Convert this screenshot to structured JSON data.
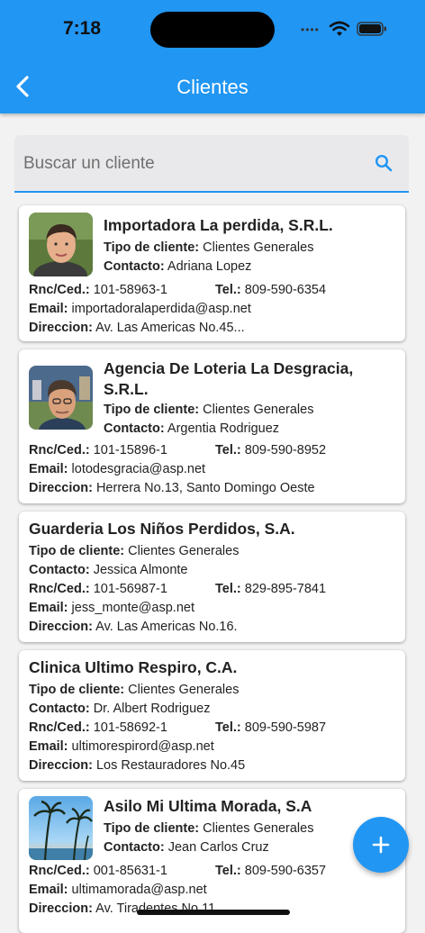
{
  "status": {
    "time": "7:18",
    "dots": "••••"
  },
  "header": {
    "title": "Clientes"
  },
  "search": {
    "placeholder": "Buscar un cliente"
  },
  "labels": {
    "tipo": "Tipo de cliente:",
    "contacto": "Contacto:",
    "rnc": "Rnc/Ced.:",
    "tel": "Tel.:",
    "email": "Email:",
    "direccion": "Direccion:"
  },
  "clients": [
    {
      "name": "Importadora La perdida, S.R.L.",
      "tipo": "Clientes Generales",
      "contacto": "Adriana Lopez",
      "rnc": "101-58963-1",
      "tel": "809-590-6354",
      "email": "importadoralaperdida@asp.net",
      "direccion": "Av. Las Americas No.45..."
    },
    {
      "name_line1": "Agencia De Loteria La Desgracia,",
      "name_line2": "S.R.L.",
      "tipo": "Clientes Generales",
      "contacto": "Argentia Rodriguez",
      "rnc": "101-15896-1",
      "tel": "809-590-8952",
      "email": "lotodesgracia@asp.net",
      "direccion": "Herrera No.13, Santo Domingo Oeste"
    },
    {
      "name": "Guarderia Los Niños Perdidos, S.A.",
      "tipo": "Clientes Generales",
      "contacto": "Jessica Almonte",
      "rnc": "101-56987-1",
      "tel": "829-895-7841",
      "email": "jess_monte@asp.net",
      "direccion": "Av. Las Americas No.16."
    },
    {
      "name": "Clinica Ultimo Respiro, C.A.",
      "tipo": "Clientes Generales",
      "contacto": "Dr. Albert Rodriguez",
      "rnc": "101-58692-1",
      "tel": "809-590-5987",
      "email": "ultimorespirord@asp.net",
      "direccion": "Los Restauradores No.45"
    },
    {
      "name": "Asilo Mi Ultima Morada, S.A",
      "tipo": "Clientes Generales",
      "contacto": "Jean Carlos Cruz",
      "rnc": "001-85631-1",
      "tel": "809-590-6357",
      "email": "ultimamorada@asp.net",
      "direccion": "Av. Tiradentes No.11"
    }
  ],
  "icons": {
    "back": "chevron-left-icon",
    "search": "search-icon",
    "add": "plus-icon"
  },
  "colors": {
    "primary": "#2196f3"
  }
}
